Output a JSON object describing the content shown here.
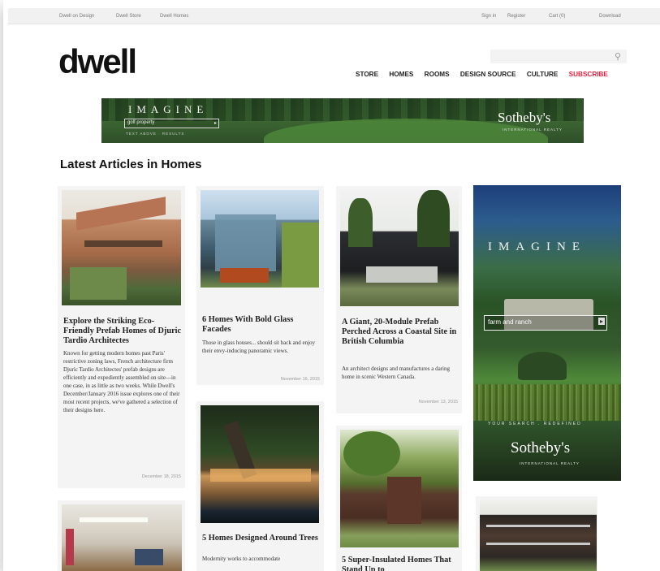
{
  "utility_bar": {
    "links": [
      "Dwell on Design",
      "Dwell Store",
      "Dwell Homes"
    ],
    "right": {
      "sign_in": "Sign in",
      "register": "Register",
      "cart": "Cart (0)",
      "download": "Download"
    }
  },
  "header": {
    "logo": "dwell",
    "nav": [
      "STORE",
      "HOMES",
      "ROOMS",
      "DESIGN SOURCE",
      "CULTURE"
    ],
    "subscribe": "SUBSCRIBE"
  },
  "banner_ad": {
    "headline": "IMAGINE",
    "field_text": "golf property",
    "field_arrow": "▸",
    "subline": "TEXT ABOVE · RESULTS",
    "brand": "Sotheby's",
    "brand_sub": "INTERNATIONAL REALTY"
  },
  "section": {
    "title": "Latest Articles in Homes"
  },
  "articles": [
    {
      "title": "Explore the Striking Eco-Friendly Prefab Homes of Djuric Tardio Architectes",
      "description": "Known for getting modern homes past Paris' restrictive zoning laws, French architecture firm Djuric Tardio Architectes' prefab designs are efficiently and expediently assembled on site—in one case, in as little as two weeks. While Dwell's December/January 2016 issue explores one of their most recent projects, we've gathered a selection of their designs here.",
      "date": "December 18, 2015"
    },
    {
      "title": "6 Homes With Bold Glass Facades",
      "description": "Those in glass houses... should sit back and enjoy their envy-inducing panoramic views.",
      "date": "November 16, 2015"
    },
    {
      "title": "A Giant, 20-Module Prefab Perched Across a Coastal Site in British Columbia",
      "description": "An architect designs and manufactures a daring home in scenic Western Canada.",
      "date": "November 13, 2015"
    },
    {
      "title": "5 Homes Designed Around Trees",
      "description": "Modernity works to accommodate"
    },
    {
      "title": "5 Super-Insulated Homes That Stand Up to"
    }
  ],
  "side_ad": {
    "headline": "IMAGINE",
    "field_text": "farm and ranch",
    "field_arrow": "▸",
    "tagline": "YOUR SEARCH . REDEFINED",
    "brand": "Sotheby's",
    "brand_sub": "INTERNATIONAL REALTY"
  },
  "colors": {
    "accent_subscribe": "#e8203f",
    "utility_bar_bg": "#f1f1f1",
    "card_bg": "#f4f4f4"
  }
}
